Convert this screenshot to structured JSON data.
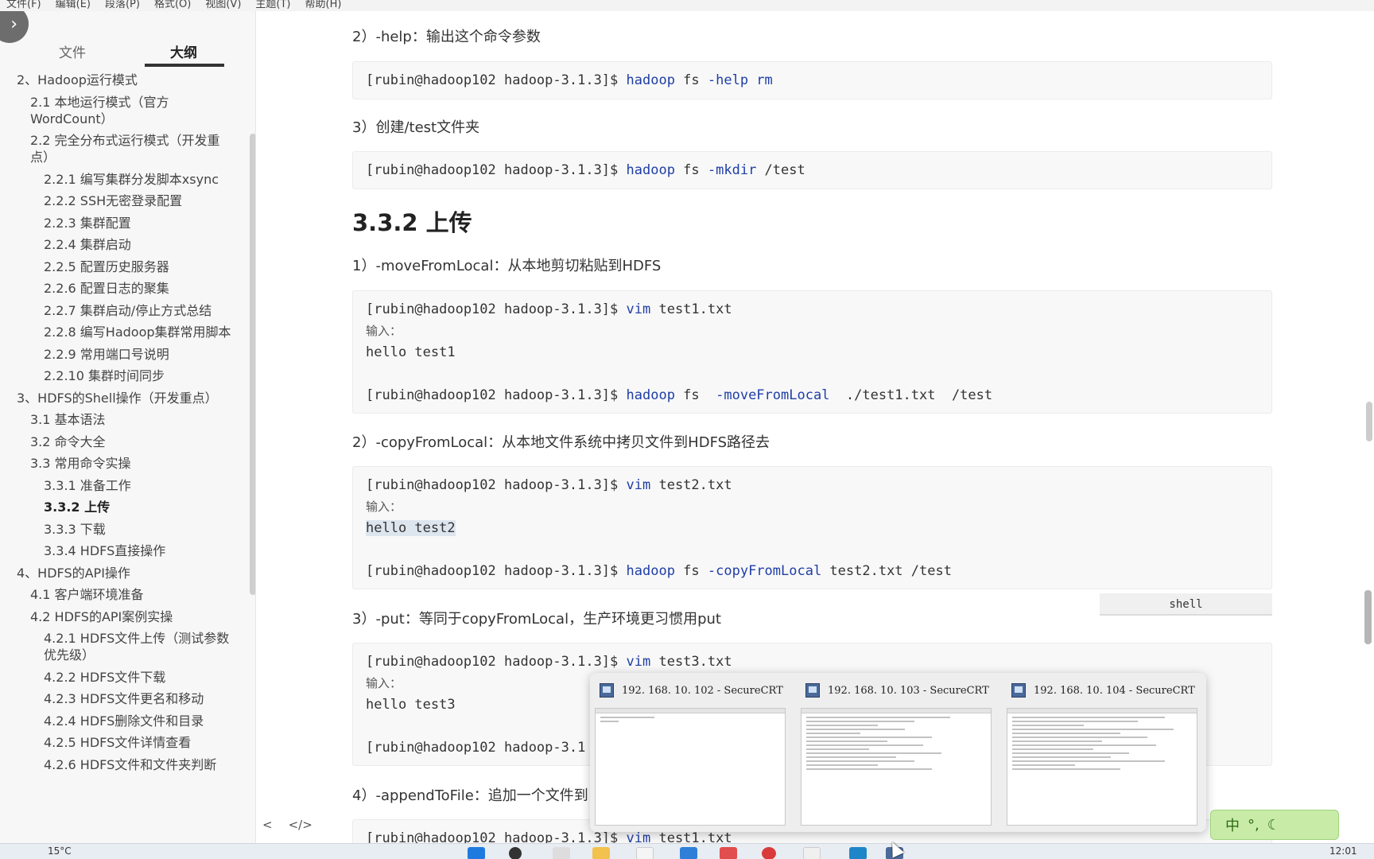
{
  "menubar": [
    "文件(F)",
    "编辑(E)",
    "段落(P)",
    "格式(O)",
    "视图(V)",
    "主题(T)",
    "帮助(H)"
  ],
  "sidebar": {
    "toggle_icon": "chevron-right",
    "tabs": {
      "files": "文件",
      "outline": "大纲"
    },
    "outline": [
      {
        "text": "2、Hadoop运行模式",
        "level": 1
      },
      {
        "text": "2.1 本地运行模式（官方WordCount）",
        "level": 2
      },
      {
        "text": "2.2 完全分布式运行模式（开发重点）",
        "level": 2
      },
      {
        "text": "2.2.1 编写集群分发脚本xsync",
        "level": 3
      },
      {
        "text": "2.2.2 SSH无密登录配置",
        "level": 3
      },
      {
        "text": "2.2.3 集群配置",
        "level": 3
      },
      {
        "text": "2.2.4 集群启动",
        "level": 3
      },
      {
        "text": "2.2.5 配置历史服务器",
        "level": 3
      },
      {
        "text": "2.2.6 配置日志的聚集",
        "level": 3
      },
      {
        "text": "2.2.7 集群启动/停止方式总结",
        "level": 3
      },
      {
        "text": "2.2.8 编写Hadoop集群常用脚本",
        "level": 3
      },
      {
        "text": "2.2.9 常用端口号说明",
        "level": 3
      },
      {
        "text": "2.2.10 集群时间同步",
        "level": 3
      },
      {
        "text": "3、HDFS的Shell操作（开发重点）",
        "level": 1
      },
      {
        "text": "3.1 基本语法",
        "level": 2
      },
      {
        "text": "3.2 命令大全",
        "level": 2
      },
      {
        "text": "3.3 常用命令实操",
        "level": 2
      },
      {
        "text": "3.3.1 准备工作",
        "level": 3
      },
      {
        "text": "3.3.2 上传",
        "level": 3
      },
      {
        "text": "3.3.3 下载",
        "level": 3
      },
      {
        "text": "3.3.4 HDFS直接操作",
        "level": 3
      },
      {
        "text": "4、HDFS的API操作",
        "level": 1
      },
      {
        "text": "4.1 客户端环境准备",
        "level": 2
      },
      {
        "text": "4.2 HDFS的API案例实操",
        "level": 2
      },
      {
        "text": "4.2.1 HDFS文件上传（测试参数优先级）",
        "level": 3
      },
      {
        "text": "4.2.2 HDFS文件下载",
        "level": 3
      },
      {
        "text": "4.2.3 HDFS文件更名和移动",
        "level": 3
      },
      {
        "text": "4.2.4 HDFS删除文件和目录",
        "level": 3
      },
      {
        "text": "4.2.5 HDFS文件详情查看",
        "level": 3
      },
      {
        "text": "4.2.6 HDFS文件和文件夹判断",
        "level": 3
      }
    ],
    "active_item": "3.3.2 上传",
    "footer": {
      "left": "<",
      "right": "</>"
    }
  },
  "doc": {
    "p_help": "2）-help：输出这个命令参数",
    "code_help": {
      "prompt": "[rubin@hadoop102 hadoop-3.1.3]$ ",
      "cmd": "hadoop",
      "rest": " fs ",
      "opt": "-help rm",
      "tail": ""
    },
    "p_mkdir": "3）创建/test文件夹",
    "code_mkdir": {
      "prompt": "[rubin@hadoop102 hadoop-3.1.3]$ ",
      "cmd": "hadoop",
      "rest": " fs ",
      "opt": "-mkdir",
      "tail": " /test"
    },
    "h_upload": "3.3.2 上传",
    "p_move": "1）-moveFromLocal：从本地剪切粘贴到HDFS",
    "code_move": {
      "l1_prompt": "[rubin@hadoop102 hadoop-3.1.3]$ ",
      "l1_cmd": "vim",
      "l1_tail": " test1.txt",
      "input_label": "输入：",
      "content": "hello test1",
      "l3_prompt": "[rubin@hadoop102 hadoop-3.1.3]$ ",
      "l3_cmd": "hadoop",
      "l3_rest": " fs  ",
      "l3_opt": "-moveFromLocal",
      "l3_tail": "  ./test1.txt  /test"
    },
    "p_copy": "2）-copyFromLocal：从本地文件系统中拷贝文件到HDFS路径去",
    "code_copy": {
      "l1_prompt": "[rubin@hadoop102 hadoop-3.1.3]$ ",
      "l1_cmd": "vim",
      "l1_tail": " test2.txt",
      "input_label": "输入：",
      "content": "hello test2",
      "l3_prompt": "[rubin@hadoop102 hadoop-3.1.3]$ ",
      "l3_cmd": "hadoop",
      "l3_rest": " fs ",
      "l3_opt": "-copyFromLocal",
      "l3_tail": " test2.txt /test"
    },
    "lang_tag": "shell",
    "p_put": "3）-put：等同于copyFromLocal，生产环境更习惯用put",
    "code_put": {
      "l1_prompt": "[rubin@hadoop102 hadoop-3.1.3]$ ",
      "l1_cmd": "vim",
      "l1_tail": " test3.txt",
      "input_label": "输入：",
      "content": "hello test3",
      "l3_prompt": "[rubin@hadoop102 hadoop-3.1"
    },
    "p_append": "4）-appendToFile：追加一个文件到",
    "code_append": {
      "prompt": "[rubin@hadoop102 hadoop-3.1.3]$ ",
      "cmd": "vim",
      "tail": " test1.txt"
    }
  },
  "taskbar_preview": [
    {
      "title": "192. 168. 10. 102 - SecureCRT"
    },
    {
      "title": "192. 168. 10. 103 - SecureCRT"
    },
    {
      "title": "192. 168. 10. 104 - SecureCRT"
    }
  ],
  "ime": {
    "label": "中",
    "icons": [
      "punctuation-icon",
      "moon-icon"
    ]
  },
  "taskbar": {
    "weather": "15°C",
    "clock": "12:01"
  },
  "colors": {
    "command": "#1f3ea6",
    "code_bg": "#f8f8f8",
    "sidebar_bg": "#f7f7f7"
  }
}
